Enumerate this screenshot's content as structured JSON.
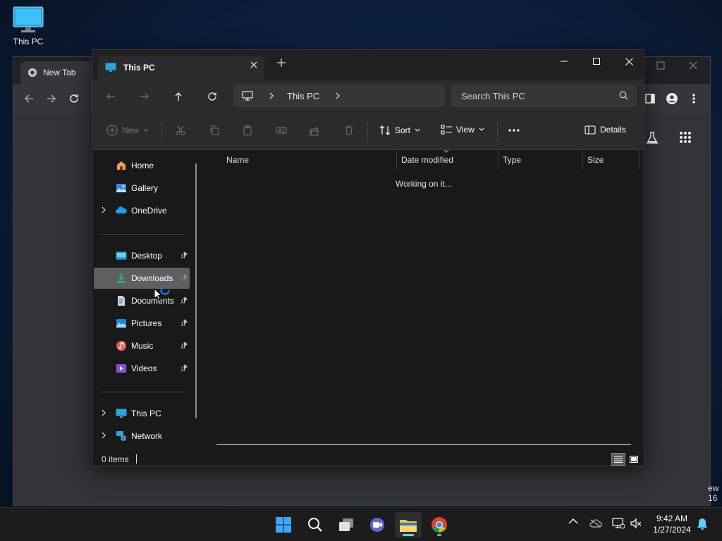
{
  "desktop": {
    "icons": [
      {
        "label": "This PC",
        "icon": "computer-icon"
      }
    ],
    "edge_text": [
      "ew",
      "16"
    ]
  },
  "chrome": {
    "tab_title": "New Tab",
    "icon": "chrome-icon"
  },
  "explorer": {
    "tab_title": "This PC",
    "address": {
      "segments": [
        "This PC"
      ]
    },
    "search": {
      "placeholder": "Search This PC"
    },
    "commands": {
      "new": "New",
      "sort": "Sort",
      "view": "View",
      "details": "Details"
    },
    "nav_pane": {
      "quick": [
        {
          "label": "Home",
          "icon": "home-icon"
        },
        {
          "label": "Gallery",
          "icon": "gallery-icon"
        },
        {
          "label": "OneDrive",
          "icon": "onedrive-icon",
          "expandable": true
        }
      ],
      "pinned": [
        {
          "label": "Desktop",
          "icon": "desktop-folder-icon",
          "pinned": true
        },
        {
          "label": "Downloads",
          "icon": "downloads-folder-icon",
          "pinned": true,
          "selected": true
        },
        {
          "label": "Documents",
          "icon": "documents-folder-icon",
          "pinned": true
        },
        {
          "label": "Pictures",
          "icon": "pictures-folder-icon",
          "pinned": true
        },
        {
          "label": "Music",
          "icon": "music-folder-icon",
          "pinned": true
        },
        {
          "label": "Videos",
          "icon": "videos-folder-icon",
          "pinned": true
        }
      ],
      "locations": [
        {
          "label": "This PC",
          "icon": "this-pc-icon",
          "expandable": true
        },
        {
          "label": "Network",
          "icon": "network-icon",
          "expandable": true
        }
      ]
    },
    "columns": [
      "Name",
      "Date modified",
      "Type",
      "Size"
    ],
    "status_message": "Working on it...",
    "status_bar": {
      "item_count": "0 items"
    }
  },
  "taskbar": {
    "apps": [
      "start-icon",
      "search-icon",
      "task-view-icon",
      "teams-icon",
      "file-explorer-icon",
      "chrome-icon"
    ],
    "clock": {
      "time": "9:42 AM",
      "date": "1/27/2024"
    }
  },
  "colors": {
    "accent": "#60cdff",
    "window_bg": "#191919",
    "toolbar_bg": "#2b2b2b",
    "selected_bg": "#5f5f5f"
  }
}
